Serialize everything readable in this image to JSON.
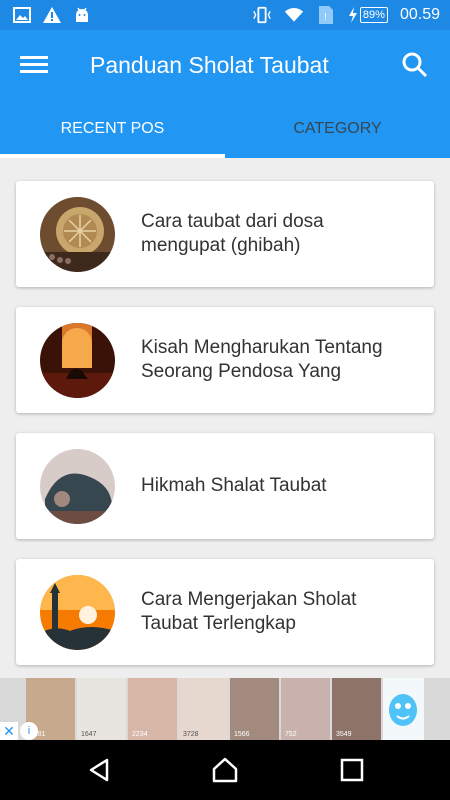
{
  "status_bar": {
    "battery": "89%",
    "time": "00.59",
    "icons": [
      "image-icon",
      "warning-icon",
      "android-icon",
      "vibrate-icon",
      "wifi-icon",
      "sim-icon",
      "charging-icon"
    ]
  },
  "app_bar": {
    "title": "Panduan Sholat Taubat",
    "menu_icon": "menu-icon",
    "search_icon": "search-icon"
  },
  "tabs": [
    {
      "label": "RECENT POS",
      "active": true
    },
    {
      "label": "CATEGORY",
      "active": false
    }
  ],
  "posts": [
    {
      "title": "Cara taubat dari dosa mengupat (ghibah)"
    },
    {
      "title": "Kisah Mengharukan Tentang Seorang Pendosa Yang"
    },
    {
      "title": "Hikmah Shalat Taubat"
    },
    {
      "title": "Cara Mengerjakan Sholat Taubat Terlengkap"
    }
  ],
  "ad": {
    "counts": [
      "3281",
      "1647",
      "2234",
      "3728",
      "1566",
      "752",
      "3549"
    ],
    "close_icon": "close-icon",
    "info_icon": "info-icon"
  },
  "nav_bar": {
    "icons": [
      "back-icon",
      "home-icon",
      "recents-icon"
    ]
  },
  "colors": {
    "primary": "#2196f3",
    "status": "#1e88e5",
    "background": "#eeeeee"
  }
}
